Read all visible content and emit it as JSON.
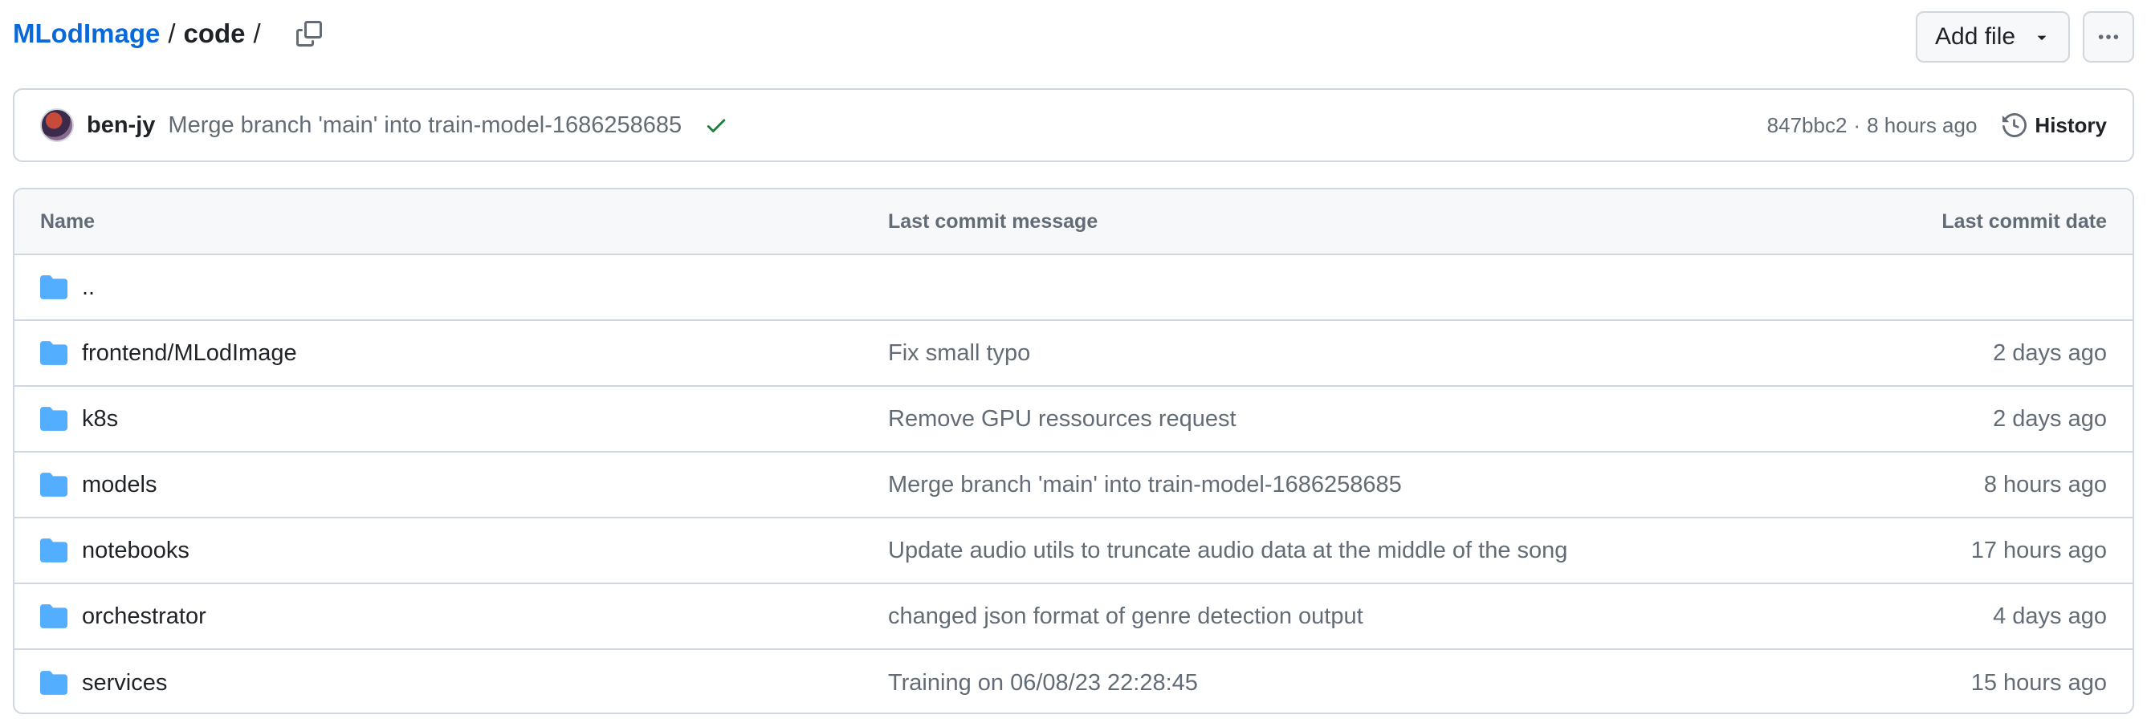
{
  "breadcrumb": {
    "repo": "MLodImage",
    "sep1": "/",
    "folder": "code",
    "sep2": "/"
  },
  "actions": {
    "add_file": "Add file",
    "more": "···"
  },
  "latest_commit": {
    "author": "ben-jy",
    "message": "Merge branch 'main' into train-model-1686258685",
    "sha": "847bbc2",
    "separator": "·",
    "time": "8 hours ago",
    "history_label": "History"
  },
  "table": {
    "headers": {
      "name": "Name",
      "message": "Last commit message",
      "date": "Last commit date"
    },
    "rows": [
      {
        "name": "..",
        "message": "",
        "date": ""
      },
      {
        "name": "frontend/MLodImage",
        "message": "Fix small typo",
        "date": "2 days ago"
      },
      {
        "name": "k8s",
        "message": "Remove GPU ressources request",
        "date": "2 days ago"
      },
      {
        "name": "models",
        "message": "Merge branch 'main' into train-model-1686258685",
        "date": "8 hours ago"
      },
      {
        "name": "notebooks",
        "message": "Update audio utils to truncate audio data at the middle of the song",
        "date": "17 hours ago"
      },
      {
        "name": "orchestrator",
        "message": "changed json format of genre detection output",
        "date": "4 days ago"
      },
      {
        "name": "services",
        "message": "Training on 06/08/23 22:28:45",
        "date": "15 hours ago"
      }
    ]
  },
  "colors": {
    "link": "#0969da",
    "folder": "#54aeff",
    "success": "#1a7f37",
    "muted": "#636c76",
    "border": "#d0d7de"
  },
  "icons": {
    "copy": "copy-icon",
    "dropdown": "triangle-down-icon",
    "more": "kebab-horizontal-icon",
    "check": "check-icon",
    "history": "history-icon",
    "folder": "folder-icon"
  }
}
